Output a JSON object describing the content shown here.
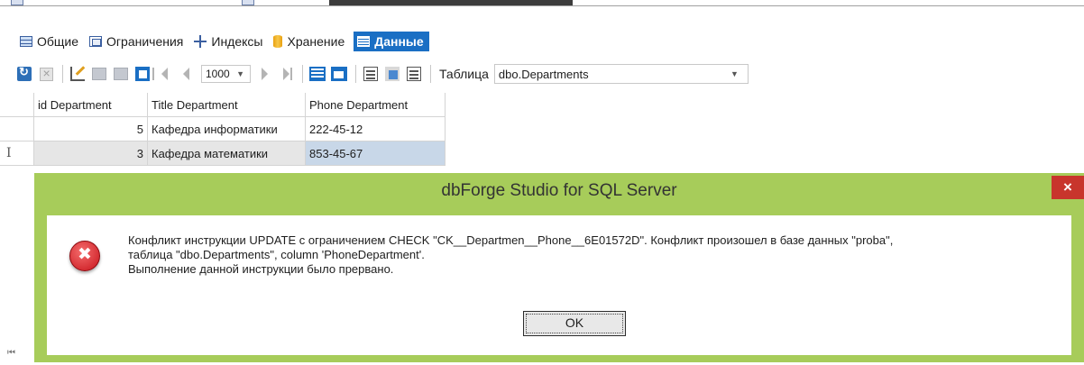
{
  "tabs": [
    {
      "label": "Общие"
    },
    {
      "label": "Ограничения"
    },
    {
      "label": "Индексы"
    },
    {
      "label": "Хранение"
    },
    {
      "label": "Данные",
      "active": true
    }
  ],
  "toolbar": {
    "page_size": "1000",
    "table_label": "Таблица",
    "table_value": "dbo.Departments"
  },
  "grid": {
    "columns": [
      "id Department",
      "Title Department",
      "Phone Department"
    ],
    "rows": [
      [
        "5",
        "Кафедра информатики",
        "222-45-12"
      ],
      [
        "3",
        "Кафедра математики",
        "853-45-67"
      ]
    ],
    "row_marker": "I",
    "nav_first_glyph": "⏮"
  },
  "dialog": {
    "title": "dbForge Studio for SQL Server",
    "close": "×",
    "message_line1": "Конфликт инструкции UPDATE с ограничением CHECK \"CK__Departmen__Phone__6E01572D\". Конфликт произошел в базе данных \"proba\",",
    "message_line2": "таблица \"dbo.Departments\", column 'PhoneDepartment'.",
    "message_line3": "Выполнение данной инструкции было прервано.",
    "ok": "OK"
  },
  "colors": {
    "accent": "#1a6fc4",
    "dialog_frame": "#a7cc5a",
    "close_button": "#c8352c",
    "error_icon": "#c8141c"
  },
  "icons": [
    "table-grid-icon",
    "constraints-icon",
    "indexes-icon",
    "storage-icon",
    "data-icon",
    "refresh-icon",
    "cancel-icon",
    "edit-icon",
    "first-page-icon",
    "prev-page-icon",
    "next-page-icon",
    "last-page-icon",
    "grid-view-icon",
    "card-view-icon",
    "form-view-icon",
    "picture-view-icon",
    "error-icon"
  ]
}
